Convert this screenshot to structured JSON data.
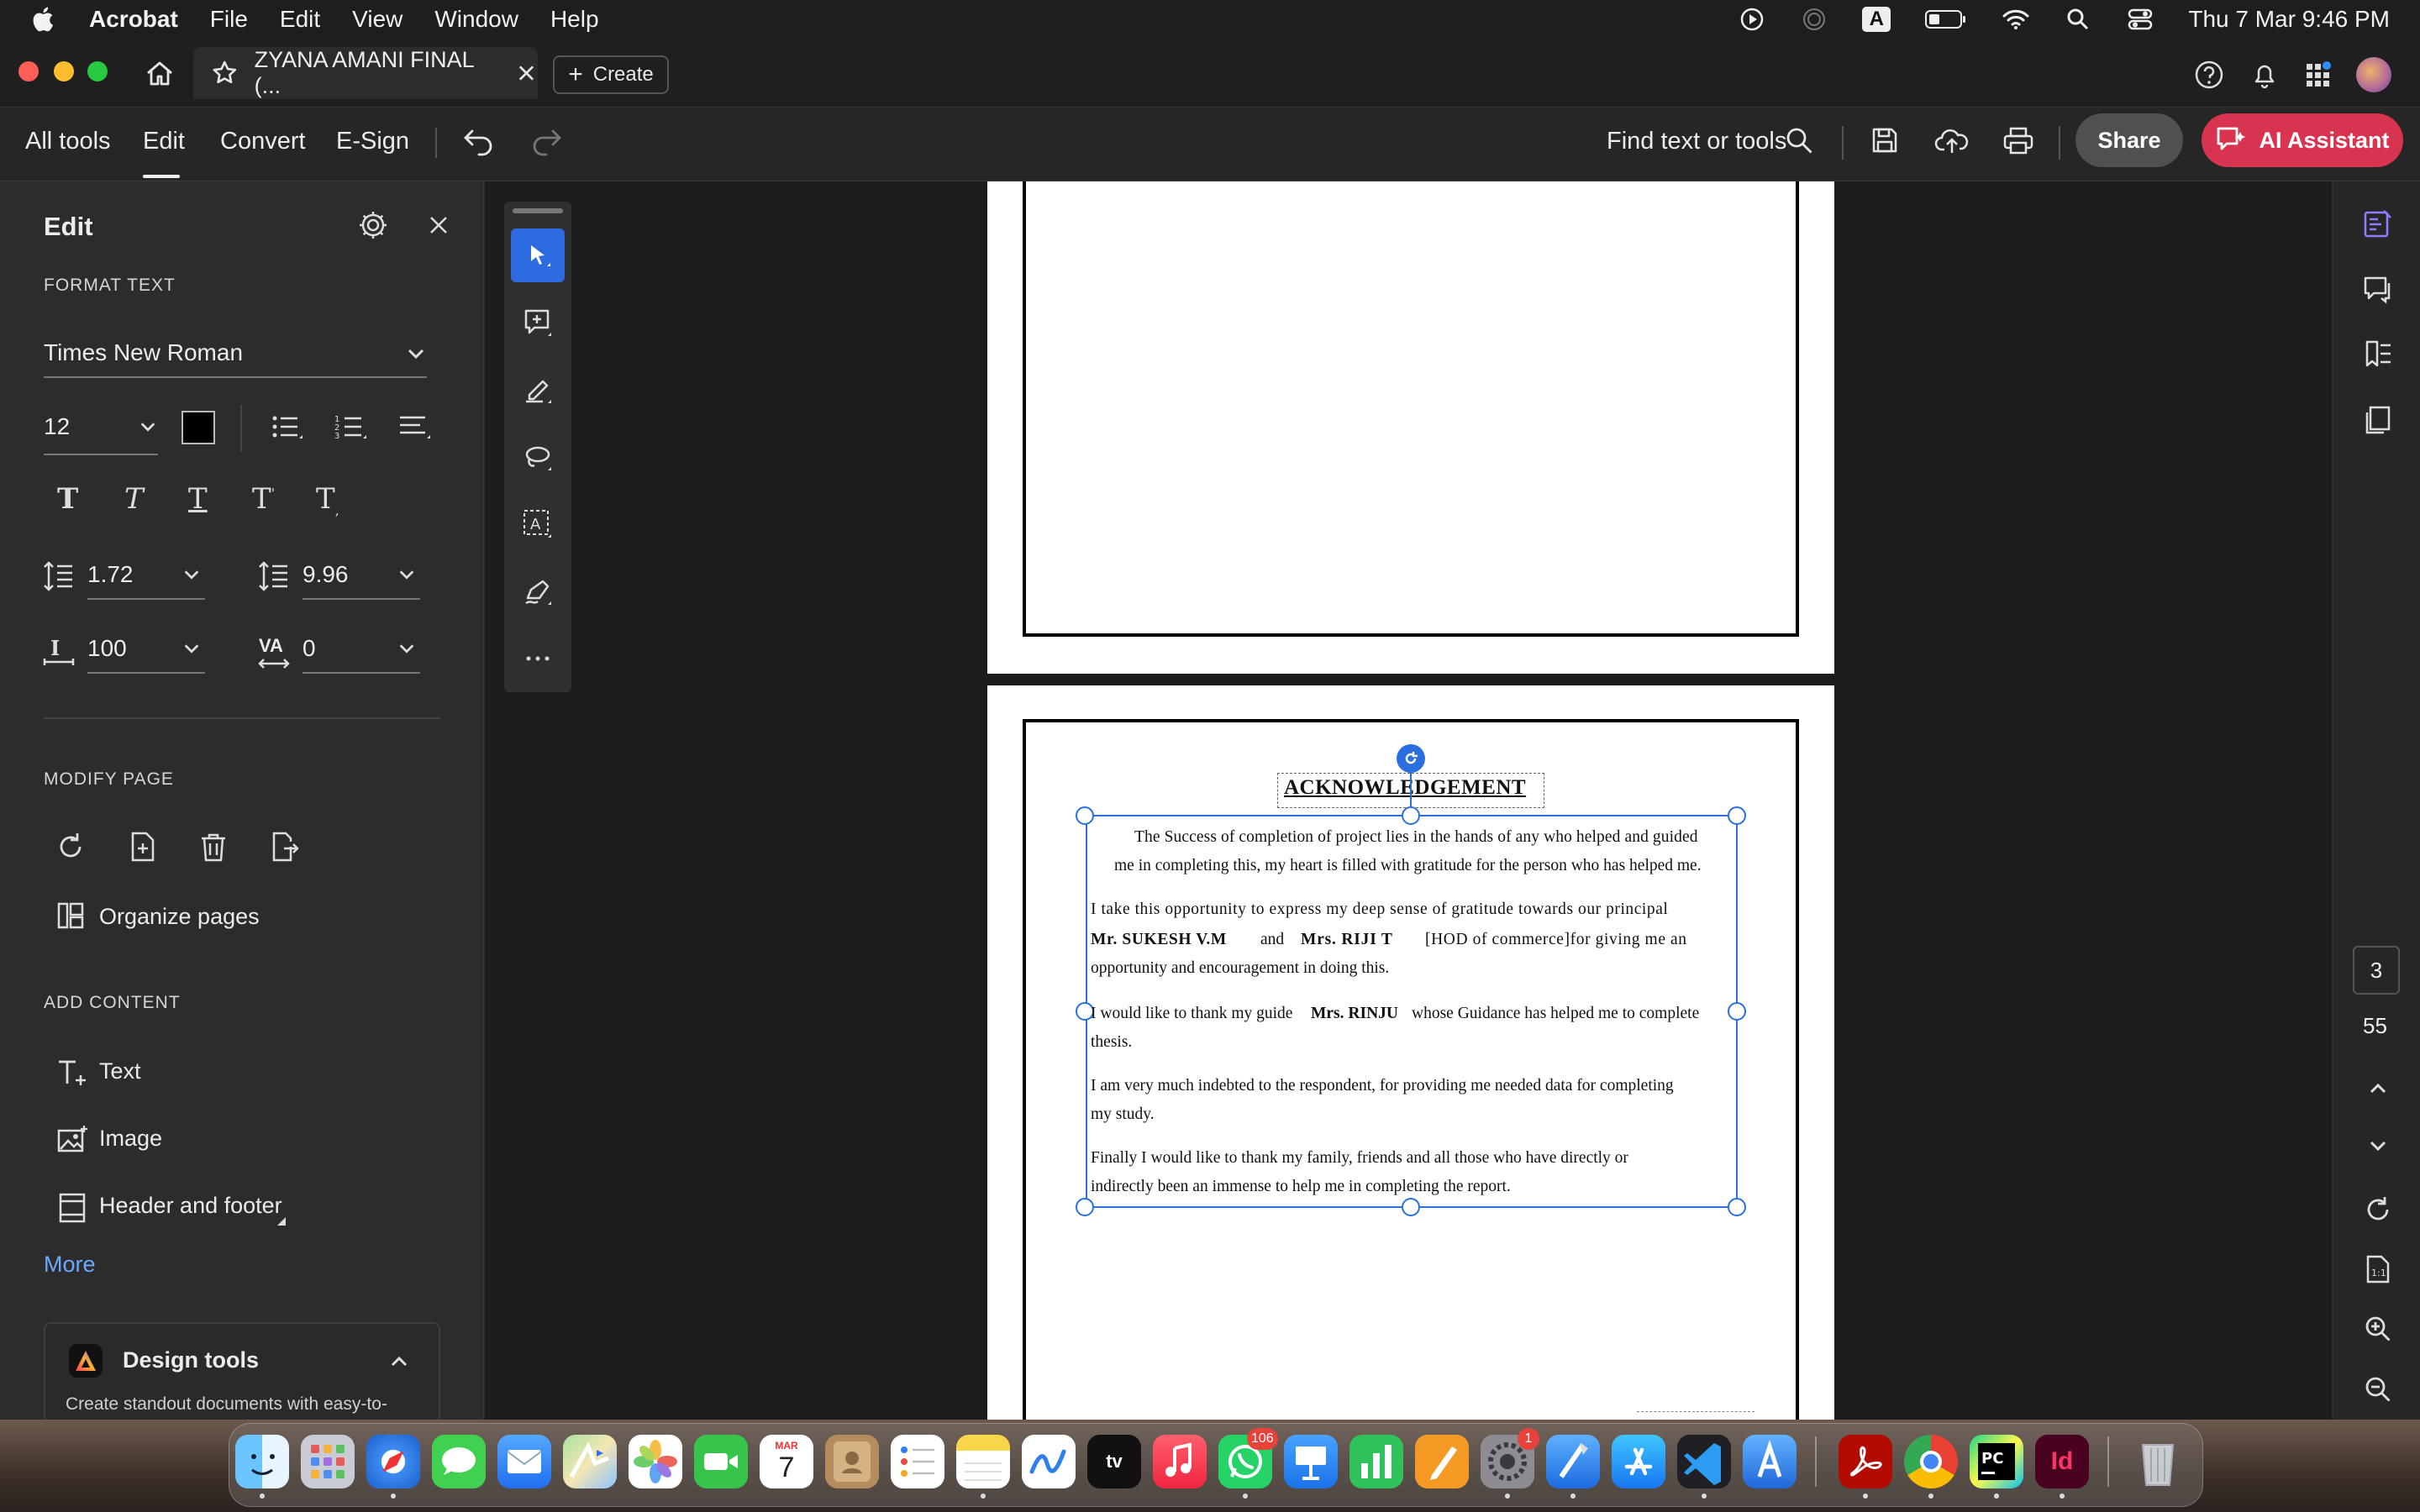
{
  "menubar": {
    "app_name": "Acrobat",
    "items": [
      "File",
      "Edit",
      "View",
      "Window",
      "Help"
    ],
    "input_indicator": "A",
    "clock": "Thu 7 Mar  9:46 PM"
  },
  "tabs": {
    "doc_title": "ZYANA AMANI FINAL (...",
    "create_label": "Create"
  },
  "toolbar": {
    "nav": [
      "All tools",
      "Edit",
      "Convert",
      "E-Sign"
    ],
    "active_nav": "Edit",
    "search_label": "Find text or tools",
    "share_label": "Share",
    "ai_label": "AI Assistant"
  },
  "edit_panel": {
    "title": "Edit",
    "format_text_heading": "FORMAT TEXT",
    "font_name": "Times New Roman",
    "font_size": "12",
    "text_color": "#000000",
    "line_spacing": "1.72",
    "para_spacing": "9.96",
    "horizontal_scale": "100",
    "char_spacing_label": "VA",
    "char_spacing": "0",
    "modify_page_heading": "MODIFY PAGE",
    "organize_pages": "Organize pages",
    "add_content_heading": "ADD CONTENT",
    "add_items": [
      "Text",
      "Image",
      "Header and footer"
    ],
    "more_label": "More",
    "design_tools_title": "Design tools",
    "design_tools_desc": "Create standout documents with easy-to-"
  },
  "document": {
    "heading": "ACKNOWLEDGEMENT",
    "lines": [
      "The Success of completion of project lies in the hands of any who helped and guided",
      "me in completing this, my heart is filled with gratitude for the person who has helped me.",
      "I take this opportunity to express my deep sense of gratitude towards our principal",
      "Mr. SUKESH V.M",
      "and",
      "Mrs. RIJI T",
      "[HOD of commerce]for giving me an",
      "opportunity and encouragement in doing this.",
      "I would like to thank my guide",
      "Mrs. RINJU",
      "whose Guidance has helped me to complete",
      "thesis.",
      "I am very much indebted to the respondent, for providing me needed data for completing",
      "my study.",
      "Finally I would like to thank my family, friends and all those who have directly or",
      "indirectly been an immense to help me in completing the report."
    ]
  },
  "page_nav": {
    "current_page": "3",
    "total_pages": "55"
  },
  "dock": {
    "calendar_month": "MAR",
    "calendar_day": "7",
    "whatsapp_badge": "106",
    "settings_badge": "1",
    "apps": [
      "Finder",
      "Launchpad",
      "Safari",
      "Messages",
      "Mail",
      "Maps",
      "Photos",
      "FaceTime",
      "Calendar",
      "Contacts",
      "Reminders",
      "Notes",
      "Freeform",
      "TV",
      "Music",
      "WhatsApp",
      "Keynote",
      "Numbers",
      "Pages",
      "System Settings",
      "Xcode",
      "App Store",
      "VS Code",
      "Instruments",
      "Acrobat",
      "Chrome",
      "PyCharm",
      "InDesign",
      "Trash"
    ]
  }
}
